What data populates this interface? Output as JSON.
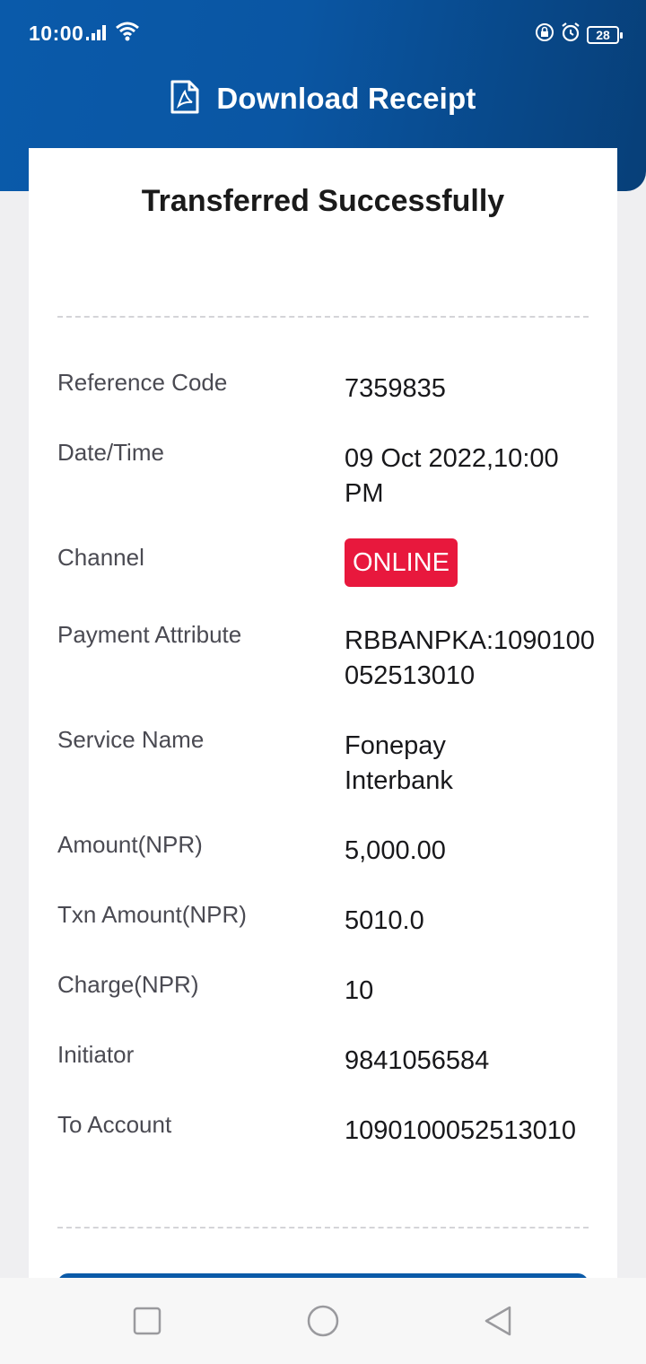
{
  "status_bar": {
    "time": "10:00",
    "battery": "28",
    "icons": [
      "signal-icon",
      "wifi-icon",
      "lock-rotation-icon",
      "alarm-icon",
      "battery-icon"
    ]
  },
  "header": {
    "title": "Download Receipt",
    "icon": "pdf-file-icon",
    "color": "#0a5aaa"
  },
  "receipt": {
    "title": "Transferred Successfully",
    "rows": [
      {
        "label": "Reference Code",
        "value": "7359835"
      },
      {
        "label": "Date/Time",
        "value": "09 Oct 2022,10:00 PM"
      },
      {
        "label": "Channel",
        "value": "ONLINE"
      },
      {
        "label": "Payment Attribute",
        "value": "RBBANPKA:1090100052513010"
      },
      {
        "label": "Service Name",
        "value": "Fonepay Interbank"
      },
      {
        "label": "Amount(NPR)",
        "value": "5,000.00"
      },
      {
        "label": "Txn Amount(NPR)",
        "value": "5010.0"
      },
      {
        "label": "Charge(NPR)",
        "value": "10"
      },
      {
        "label": "Initiator",
        "value": "9841056584"
      },
      {
        "label": "To Account",
        "value": "1090100052513010"
      }
    ],
    "badge_color": "#e8183d"
  },
  "nav_bar": {
    "buttons": [
      "recent-apps-icon",
      "home-icon",
      "back-icon"
    ]
  }
}
